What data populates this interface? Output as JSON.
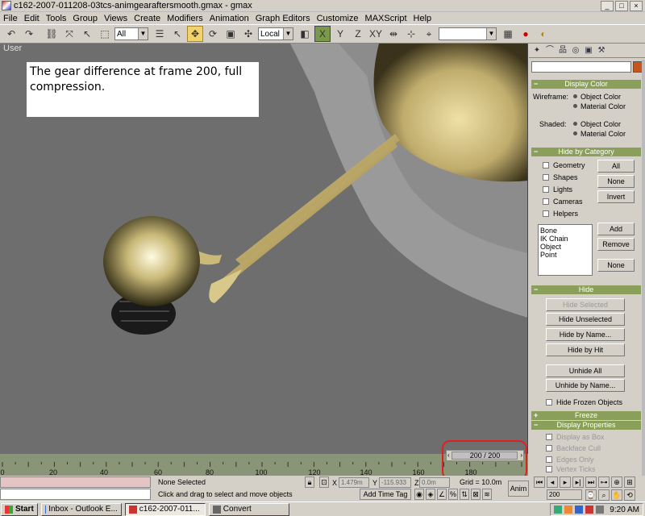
{
  "window": {
    "title": "c162-2007-011208-03tcs-animgearaftersmooth.gmax - gmax",
    "minimize": "_",
    "maximize": "□",
    "close": "×"
  },
  "menu": [
    "File",
    "Edit",
    "Tools",
    "Group",
    "Views",
    "Create",
    "Modifiers",
    "Animation",
    "Graph Editors",
    "Customize",
    "MAXScript",
    "Help"
  ],
  "toolbar": {
    "selection_filter": "All",
    "coord_system": "Local",
    "axis_x": "X",
    "axis_y": "Y",
    "axis_z": "Z",
    "axis_xy": "XY",
    "named_sel": ""
  },
  "viewport": {
    "label": "User",
    "annotation": "The gear difference at frame 200, full compression."
  },
  "command_panel": {
    "display_color": {
      "title": "Display Color",
      "wireframe_label": "Wireframe:",
      "shaded_label": "Shaded:",
      "object_color": "Object Color",
      "material_color": "Material Color"
    },
    "hide_by_category": {
      "title": "Hide by Category",
      "items": [
        "Geometry",
        "Shapes",
        "Lights",
        "Cameras",
        "Helpers"
      ],
      "all_btn": "All",
      "none_btn": "None",
      "invert_btn": "Invert",
      "list": [
        "Bone",
        "IK Chain Object",
        "Point"
      ],
      "add_btn": "Add",
      "remove_btn": "Remove",
      "none2_btn": "None"
    },
    "hide": {
      "title": "Hide",
      "hide_selected": "Hide Selected",
      "hide_unselected": "Hide Unselected",
      "hide_by_name": "Hide by Name...",
      "hide_by_hit": "Hide by Hit",
      "unhide_all": "Unhide All",
      "unhide_by_name": "Unhide by Name...",
      "hide_frozen": "Hide Frozen Objects"
    },
    "freeze": {
      "title": "Freeze"
    },
    "display_properties": {
      "title": "Display Properties",
      "items": [
        "Display as Box",
        "Backface Cull",
        "Edges Only",
        "Vertex Ticks"
      ]
    }
  },
  "time": {
    "slider": "200 / 200",
    "ticks": [
      "0",
      "20",
      "40",
      "60",
      "80",
      "100",
      "120",
      "140",
      "160",
      "180"
    ]
  },
  "status": {
    "selection": "None Selected",
    "prompt": "Click and drag to select and move objects",
    "x_label": "X",
    "x_value": "1.479m",
    "y_label": "Y",
    "y_value": "-115.933",
    "z_label": "Z",
    "z_value": "0.0m",
    "grid": "Grid = 10.0m",
    "add_time_tag": "Add Time Tag",
    "anim": "Anim",
    "frame": "200"
  },
  "taskbar": {
    "start": "Start",
    "tasks": [
      "Inbox - Outlook E...",
      "c162-2007-011...",
      "Convert"
    ],
    "clock": "9:20 AM"
  },
  "colors": {
    "viewport_bg": "#6e6e6e",
    "rollout_header": "#8aa05a",
    "timeline": "#8a9577",
    "annotation_ring": "#e02020"
  }
}
